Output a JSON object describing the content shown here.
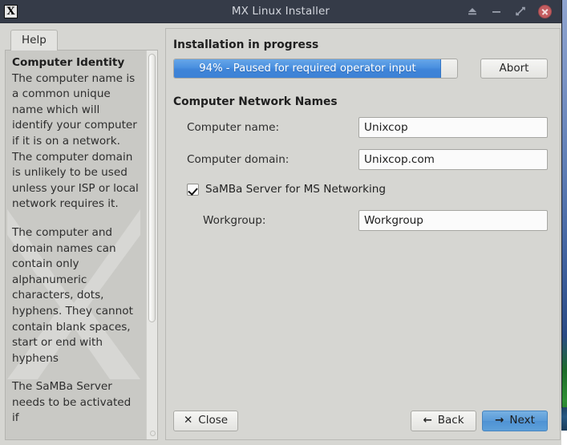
{
  "window": {
    "title": "MX Linux Installer",
    "app_icon": "mx-logo-icon",
    "titlebar_buttons": {
      "shade_label": "▲",
      "minimize_label": "—",
      "maximize_label": "□",
      "close_label": "✕"
    }
  },
  "help_pane": {
    "tab_label": "Help",
    "heading": "Computer Identity",
    "paragraph1": "The computer name is a common unique name which will identify your computer if it is on a network. The computer domain is unlikely to be used unless your ISP or local network requires it.",
    "paragraph2": "The computer and domain names can contain only alphanumeric characters, dots, hyphens. They cannot contain blank spaces, start or end with hyphens",
    "paragraph3": "The SaMBa Server needs to be activated if"
  },
  "main": {
    "install_section_title": "Installation in progress",
    "progress": {
      "percent": 94,
      "label": "94% - Paused for required operator input",
      "fill_color": "#4a90e0"
    },
    "abort_label": "Abort",
    "network_section_title": "Computer Network Names",
    "fields": [
      {
        "label": "Computer name:",
        "value": "Unixcop"
      },
      {
        "label": "Computer domain:",
        "value": "Unixcop.com"
      }
    ],
    "samba": {
      "checkbox_label": "SaMBa Server for MS Networking",
      "checked": true,
      "workgroup_label": "Workgroup:",
      "workgroup_value": "Workgroup"
    }
  },
  "footer": {
    "close_label": "Close",
    "close_glyph": "✕",
    "back_label": "Back",
    "back_glyph": "←",
    "next_label": "Next",
    "next_glyph": "→",
    "next_accent": "#5a9bd8"
  }
}
